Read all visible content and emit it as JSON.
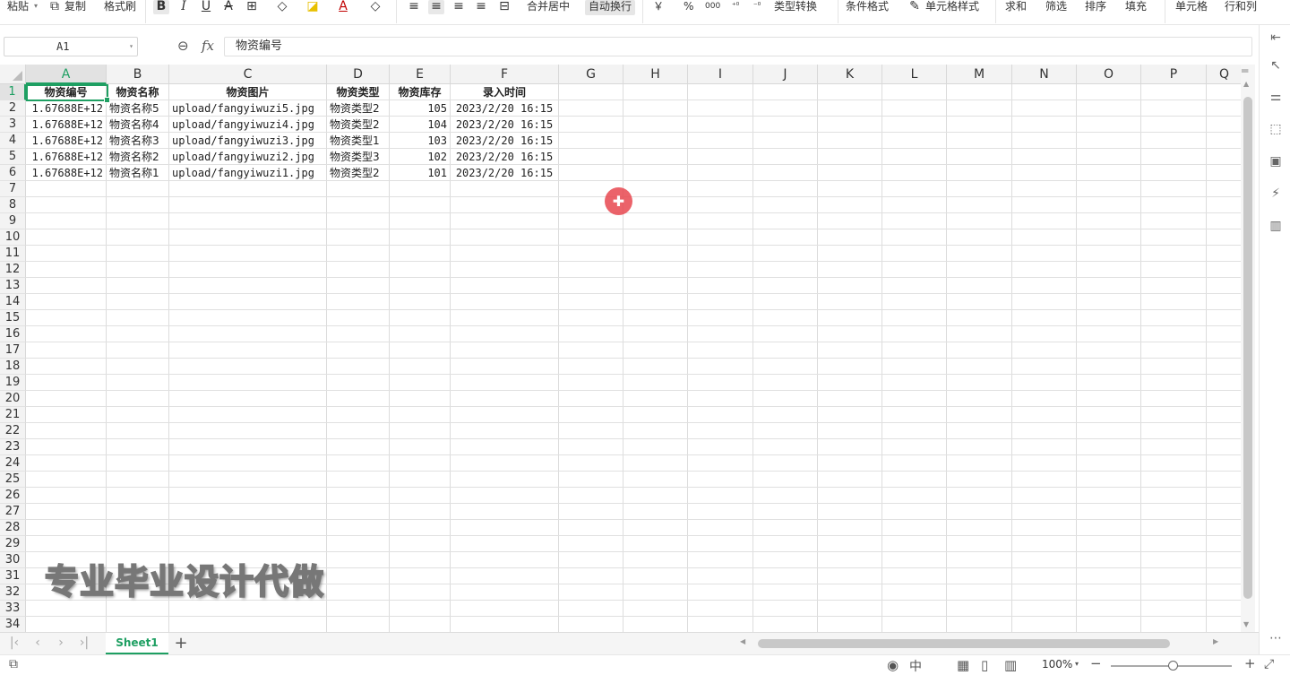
{
  "toolbar": {
    "paste": "粘贴",
    "copy": "复制",
    "format_painter": "格式刷",
    "merge_center": "合并居中",
    "auto_wrap": "自动换行",
    "currency_symbol": "￥",
    "percent_symbol": "%",
    "thousands_symbol": "000",
    "type_convert": "类型转换",
    "conditional_format": "条件格式",
    "cell_style": "单元格样式",
    "sum": "求和",
    "filter": "筛选",
    "sort": "排序",
    "fill": "填充",
    "cell": "单元格",
    "rows_cols": "行和列"
  },
  "formula_bar": {
    "name_box": "A1",
    "fx": "fx",
    "content": "物资编号"
  },
  "columns": [
    "A",
    "B",
    "C",
    "D",
    "E",
    "F",
    "G",
    "H",
    "I",
    "J",
    "K",
    "L",
    "M",
    "N",
    "O",
    "P",
    "Q"
  ],
  "rows": [
    "1",
    "2",
    "3",
    "4",
    "5",
    "6",
    "7",
    "8",
    "9",
    "10",
    "11",
    "12",
    "13",
    "14",
    "15",
    "16",
    "17",
    "18",
    "19",
    "20",
    "21",
    "22",
    "23",
    "24",
    "25",
    "26",
    "27",
    "28",
    "29",
    "30",
    "31",
    "32",
    "33",
    "34"
  ],
  "table": {
    "headers": [
      "物资编号",
      "物资名称",
      "物资图片",
      "物资类型",
      "物资库存",
      "录入时间"
    ],
    "rows": [
      [
        "1.67688E+12",
        "物资名称5",
        "upload/fangyiwuzi5.jpg",
        "物资类型2",
        "105",
        "2023/2/20 16:15"
      ],
      [
        "1.67688E+12",
        "物资名称4",
        "upload/fangyiwuzi4.jpg",
        "物资类型2",
        "104",
        "2023/2/20 16:15"
      ],
      [
        "1.67688E+12",
        "物资名称3",
        "upload/fangyiwuzi3.jpg",
        "物资类型1",
        "103",
        "2023/2/20 16:15"
      ],
      [
        "1.67688E+12",
        "物资名称2",
        "upload/fangyiwuzi2.jpg",
        "物资类型3",
        "102",
        "2023/2/20 16:15"
      ],
      [
        "1.67688E+12",
        "物资名称1",
        "upload/fangyiwuzi1.jpg",
        "物资类型2",
        "101",
        "2023/2/20 16:15"
      ]
    ]
  },
  "watermark": "专业毕业设计代做",
  "sheet_tab": "Sheet1",
  "status": {
    "zoom": "100%"
  },
  "colors": {
    "accent": "#1e9f62",
    "cursor": "#e84850"
  }
}
